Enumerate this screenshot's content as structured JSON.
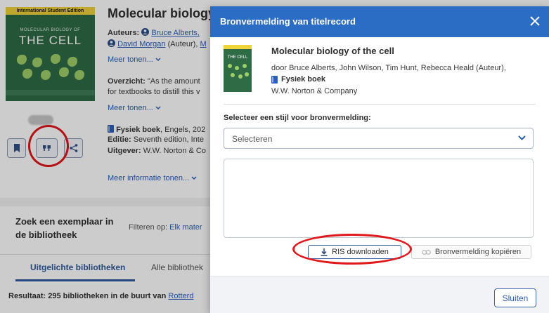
{
  "background": {
    "cover": {
      "edition_label": "International Student Edition",
      "subtitle": "MOLECULAR BIOLOGY OF",
      "title": "THE CELL"
    },
    "title": "Molecular biology c",
    "authors_label": "Auteurs:",
    "author_1": "Bruce Alberts,",
    "author_2": "David Morgan",
    "author_2_role": "(Auteur),",
    "author_2_tail": "M",
    "more_1": "Meer tonen...",
    "overview_label": "Overzicht:",
    "overview_text": "\"As the amount",
    "overview_text_2": "for textbooks to distill this v",
    "more_2": "Meer tonen...",
    "format_type": "Fysiek boek",
    "format_rest": ", Engels, 202",
    "edition_label": "Editie:",
    "edition_value": "Seventh edition, Inte",
    "publisher_label": "Uitgever:",
    "publisher_value": "W.W. Norton & Co",
    "more_info": "Meer informatie tonen...",
    "find_copy": "Zoek een exemplaar in de bibliotheek",
    "filter_label": "Filteren op:",
    "filter_value": "Elk mater",
    "tabs": [
      {
        "label": "Uitgelichte bibliotheken"
      },
      {
        "label": "Alle bibliothek"
      }
    ],
    "result_prefix": "Resultaat: 295 bibliotheken in de buurt van",
    "result_link": "Rotterd"
  },
  "modal": {
    "title": "Bronvermelding van titelrecord",
    "record": {
      "title": "Molecular biology of the cell",
      "authors": "door Bruce Alberts, John Wilson, Tim Hunt, Rebecca Heald (Auteur),",
      "type": "Fysiek boek",
      "publisher": "W.W. Norton & Company"
    },
    "style_label": "Selecteer een stijl voor bronvermelding:",
    "select_value": "Selecteren",
    "ris_button": "RIS downloaden",
    "copy_button": "Bronvermelding kopiëren",
    "close_button": "Sluiten"
  },
  "colors": {
    "primary": "#2b6cc4",
    "annotation": "#e0171b",
    "book_green": "#2f6b45"
  }
}
